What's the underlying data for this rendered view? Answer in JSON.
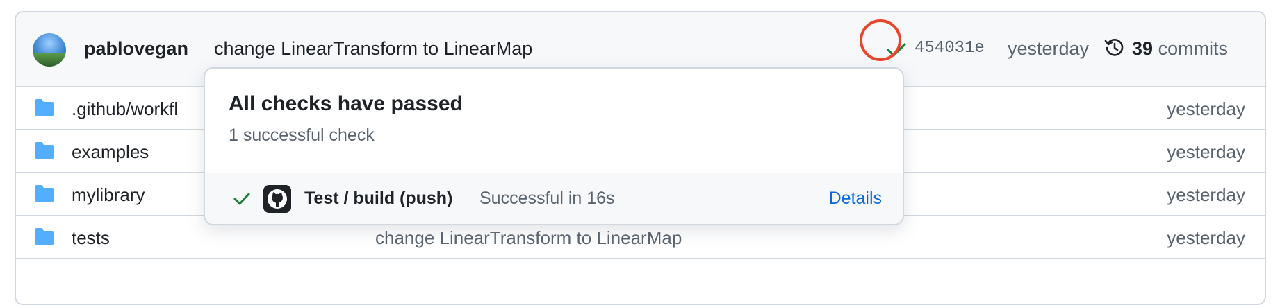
{
  "commit": {
    "author": "pablovegan",
    "message": "change LinearTransform to LinearMap",
    "sha": "454031e",
    "time": "yesterday",
    "count": "39",
    "count_label": "commits",
    "status_icon": "check-icon",
    "history_icon": "history-icon"
  },
  "files": [
    {
      "name": ".github/workfl",
      "message": "",
      "time": "yesterday",
      "icon": "folder-icon"
    },
    {
      "name": "examples",
      "message": "",
      "time": "yesterday",
      "icon": "folder-icon"
    },
    {
      "name": "mylibrary",
      "message": "",
      "time": "yesterday",
      "icon": "folder-icon"
    },
    {
      "name": "tests",
      "message": "change LinearTransform to LinearMap",
      "time": "yesterday",
      "icon": "folder-icon"
    }
  ],
  "popover": {
    "title": "All checks have passed",
    "subtitle": "1 successful check",
    "check": {
      "name": "Test / build (push)",
      "status": "Successful in 16s",
      "details_label": "Details",
      "icon": "github-logo-icon"
    }
  },
  "colors": {
    "success": "#1a7f37",
    "link": "#0969da",
    "folder": "#54aeff",
    "highlight": "#e8452b"
  }
}
